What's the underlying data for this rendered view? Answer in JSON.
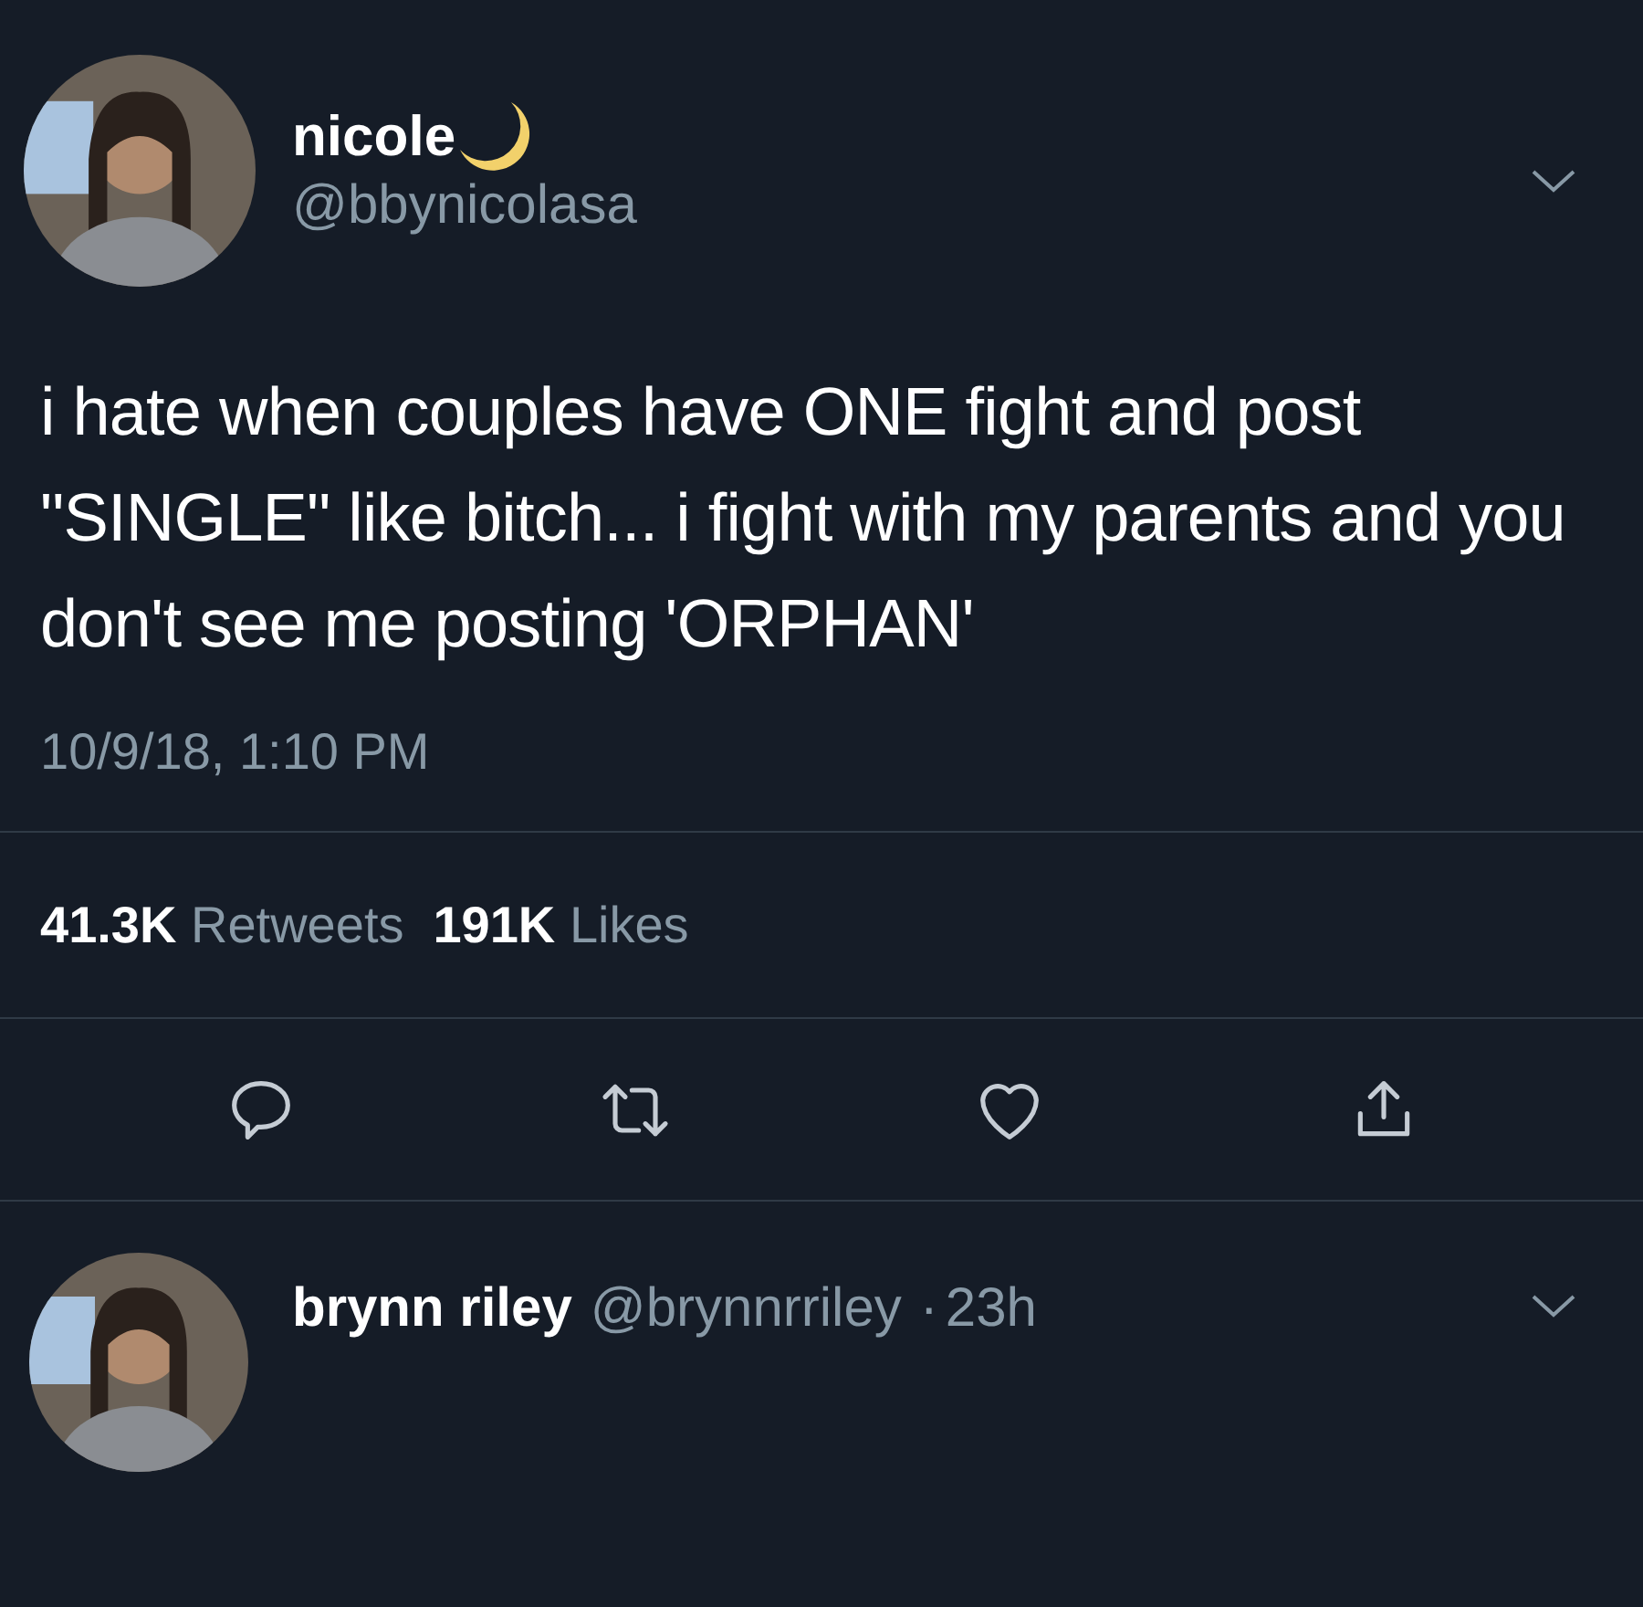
{
  "tweet": {
    "author": {
      "name": "nicole",
      "handle": "@bbynicolasa"
    },
    "text": "i hate when couples have ONE fight and post \"SINGLE\" like bitch... i fight with my parents and you don't see me posting 'ORPHAN'",
    "timestamp": "10/9/18, 1:10 PM",
    "stats": [
      {
        "count": "41.3K",
        "label": "Retweets"
      },
      {
        "count": "191K",
        "label": "Likes"
      }
    ],
    "actions": [
      {
        "kind": "reply"
      },
      {
        "kind": "retweet"
      },
      {
        "kind": "like"
      },
      {
        "kind": "share"
      }
    ]
  },
  "reply": {
    "name": "brynn riley",
    "handle": "@brynnrriley",
    "separator": "·",
    "time": "23h"
  }
}
